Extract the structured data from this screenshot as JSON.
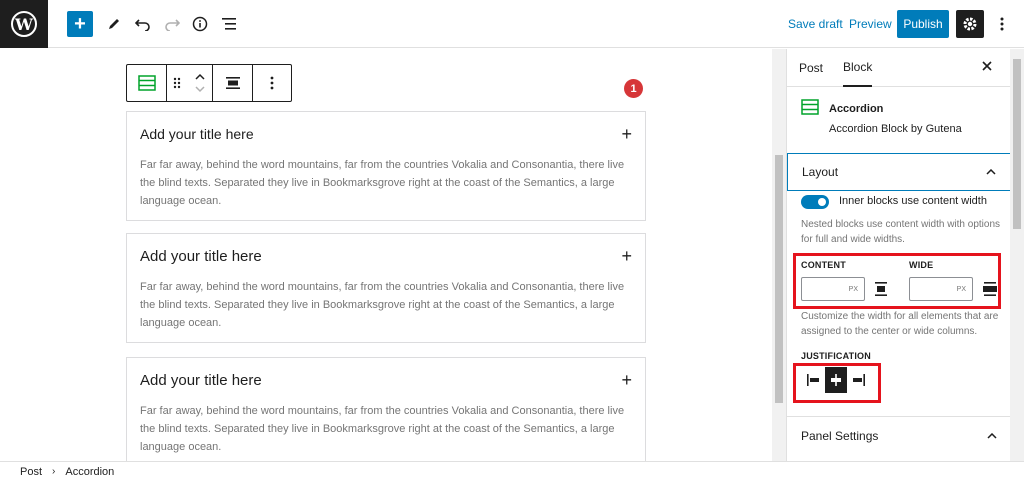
{
  "topbar": {
    "logo": "wordpress-logo",
    "save_draft": "Save draft",
    "preview": "Preview",
    "publish": "Publish"
  },
  "editor": {
    "notification_count": "1",
    "accordions": [
      {
        "title": "Add your title here",
        "body": "Far far away, behind the word mountains, far from the countries Vokalia and Consonantia, there live the blind texts. Separated they live in Bookmarksgrove right at the coast of the Semantics, a large language ocean."
      },
      {
        "title": "Add your title here",
        "body": "Far far away, behind the word mountains, far from the countries Vokalia and Consonantia, there live the blind texts. Separated they live in Bookmarksgrove right at the coast of the Semantics, a large language ocean."
      },
      {
        "title": "Add your title here",
        "body": "Far far away, behind the word mountains, far from the countries Vokalia and Consonantia, there live the blind texts. Separated they live in Bookmarksgrove right at the coast of the Semantics, a large language ocean."
      }
    ]
  },
  "sidebar": {
    "tabs": [
      {
        "label": "Post"
      },
      {
        "label": "Block"
      }
    ],
    "block_name": "Accordion",
    "block_desc": "Accordion Block by Gutena",
    "layout": {
      "title": "Layout",
      "toggle_label": "Inner blocks use content width",
      "toggle_on": true,
      "toggle_help": "Nested blocks use content width with options for full and wide widths.",
      "content_label": "CONTENT",
      "wide_label": "WIDE",
      "unit": "PX",
      "width_help": "Customize the width for all elements that are assigned to the center or wide columns.",
      "justification_label": "JUSTIFICATION"
    },
    "panel_settings": "Panel Settings"
  },
  "footer": {
    "breadcrumb": [
      {
        "label": "Post"
      },
      {
        "label": "Accordion"
      }
    ]
  },
  "colors": {
    "accent": "#007cba",
    "highlight": "#e5131d",
    "badge": "#d63638"
  }
}
